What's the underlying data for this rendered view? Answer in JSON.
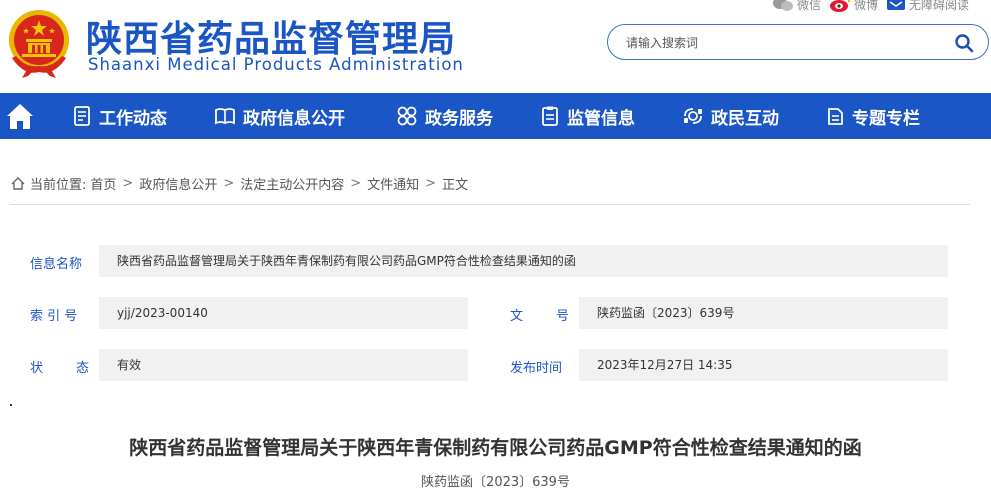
{
  "header": {
    "site_title": "陕西省药品监督管理局",
    "site_subtitle": "Shaanxi Medical Products Administration",
    "top_links": [
      {
        "label": "微信",
        "icon": "wechat-icon"
      },
      {
        "label": "微博",
        "icon": "weibo-icon"
      },
      {
        "label": "无障碍阅读",
        "icon": "accessibility-icon"
      }
    ],
    "search": {
      "placeholder": "请输入搜索词",
      "value": ""
    }
  },
  "nav": {
    "items": [
      {
        "label": "工作动态",
        "icon": "document-list-icon"
      },
      {
        "label": "政府信息公开",
        "icon": "open-book-icon"
      },
      {
        "label": "政务服务",
        "icon": "services-grid-icon"
      },
      {
        "label": "监管信息",
        "icon": "clipboard-icon"
      },
      {
        "label": "政民互动",
        "icon": "interaction-icon"
      },
      {
        "label": "专题专栏",
        "icon": "topics-icon"
      }
    ]
  },
  "breadcrumb": {
    "prefix": "当前位置:",
    "items": [
      "首页",
      "政府信息公开",
      "法定主动公开内容",
      "文件通知",
      "正文"
    ],
    "separator": ">"
  },
  "info": {
    "name_label": "信息名称",
    "name_value": "陕西省药品监督管理局关于陕西年青保制药有限公司药品GMP符合性检查结果通知的函",
    "index_label": "索 引 号",
    "index_value": "yjj/2023-00140",
    "doc_no_label": "文        号",
    "doc_no_value": "陕药监函〔2023〕639号",
    "status_label": "状        态",
    "status_value": "有效",
    "publish_label": "发布时间",
    "publish_value": "2023年12月27日 14:35"
  },
  "document": {
    "title": "陕西省药品监督管理局关于陕西年青保制药有限公司药品GMP符合性检查结果通知的函",
    "number": "陕药监函〔2023〕639号"
  },
  "colors": {
    "brand_blue": "#1a56c6",
    "emblem_red": "#d8261c",
    "emblem_gold": "#f5c400",
    "field_bg": "#f1f1f1"
  }
}
